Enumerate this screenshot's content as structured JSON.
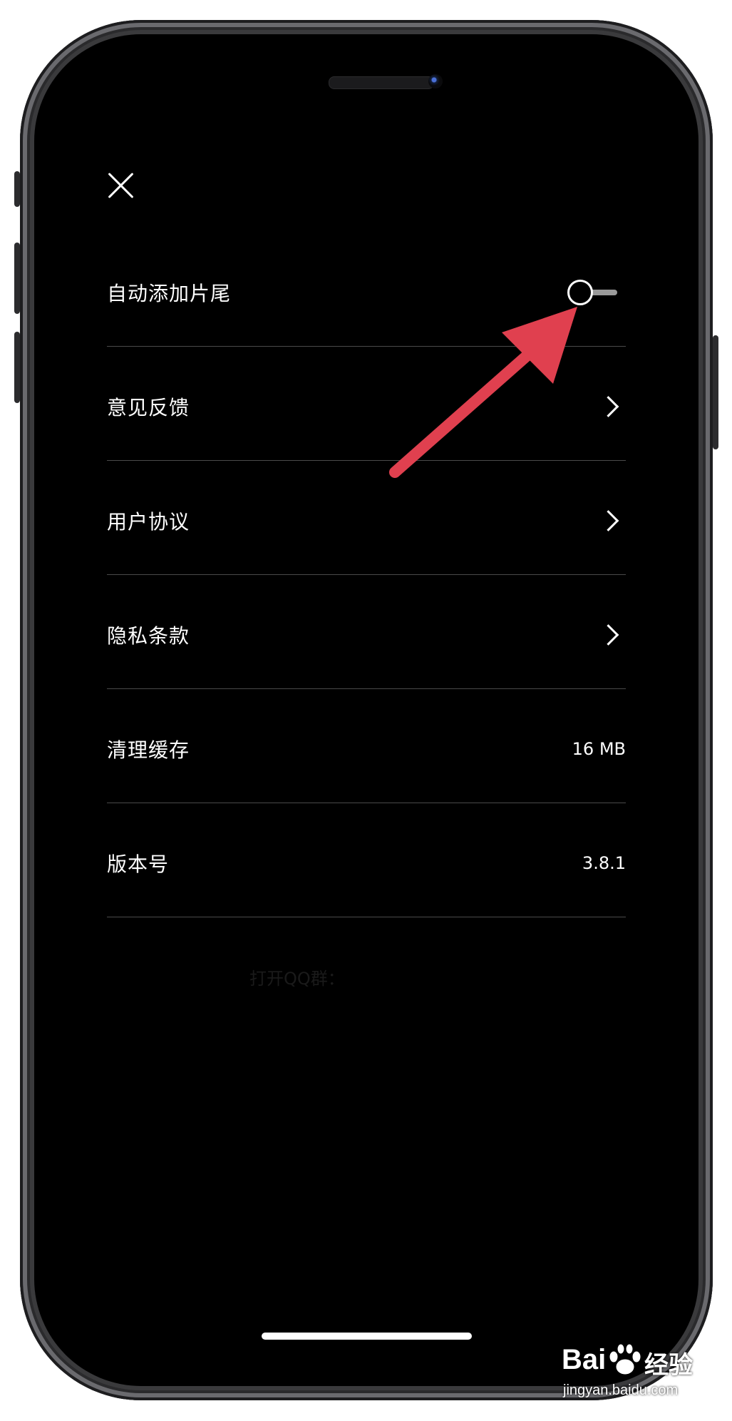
{
  "settings": {
    "items": [
      {
        "label": "自动添加片尾",
        "control": "toggle",
        "toggle_on": false
      },
      {
        "label": "意见反馈",
        "control": "chevron"
      },
      {
        "label": "用户协议",
        "control": "chevron"
      },
      {
        "label": "隐私条款",
        "control": "chevron"
      },
      {
        "label": "清理缓存",
        "control": "value",
        "value": "16 MB"
      },
      {
        "label": "版本号",
        "control": "value",
        "value": "3.8.1"
      }
    ],
    "faint_text": "打开QQ群："
  },
  "icons": {
    "close": "close-icon",
    "chevron": "chevron-right-icon",
    "toggle": "toggle-switch"
  },
  "colors": {
    "background": "#000000",
    "text": "#ffffff",
    "divider": "#4a4a4a",
    "annotation_arrow": "#e0404f"
  },
  "watermark": {
    "logo_text": "Bai",
    "brand": "经验",
    "url": "jingyan.baidu.com"
  }
}
